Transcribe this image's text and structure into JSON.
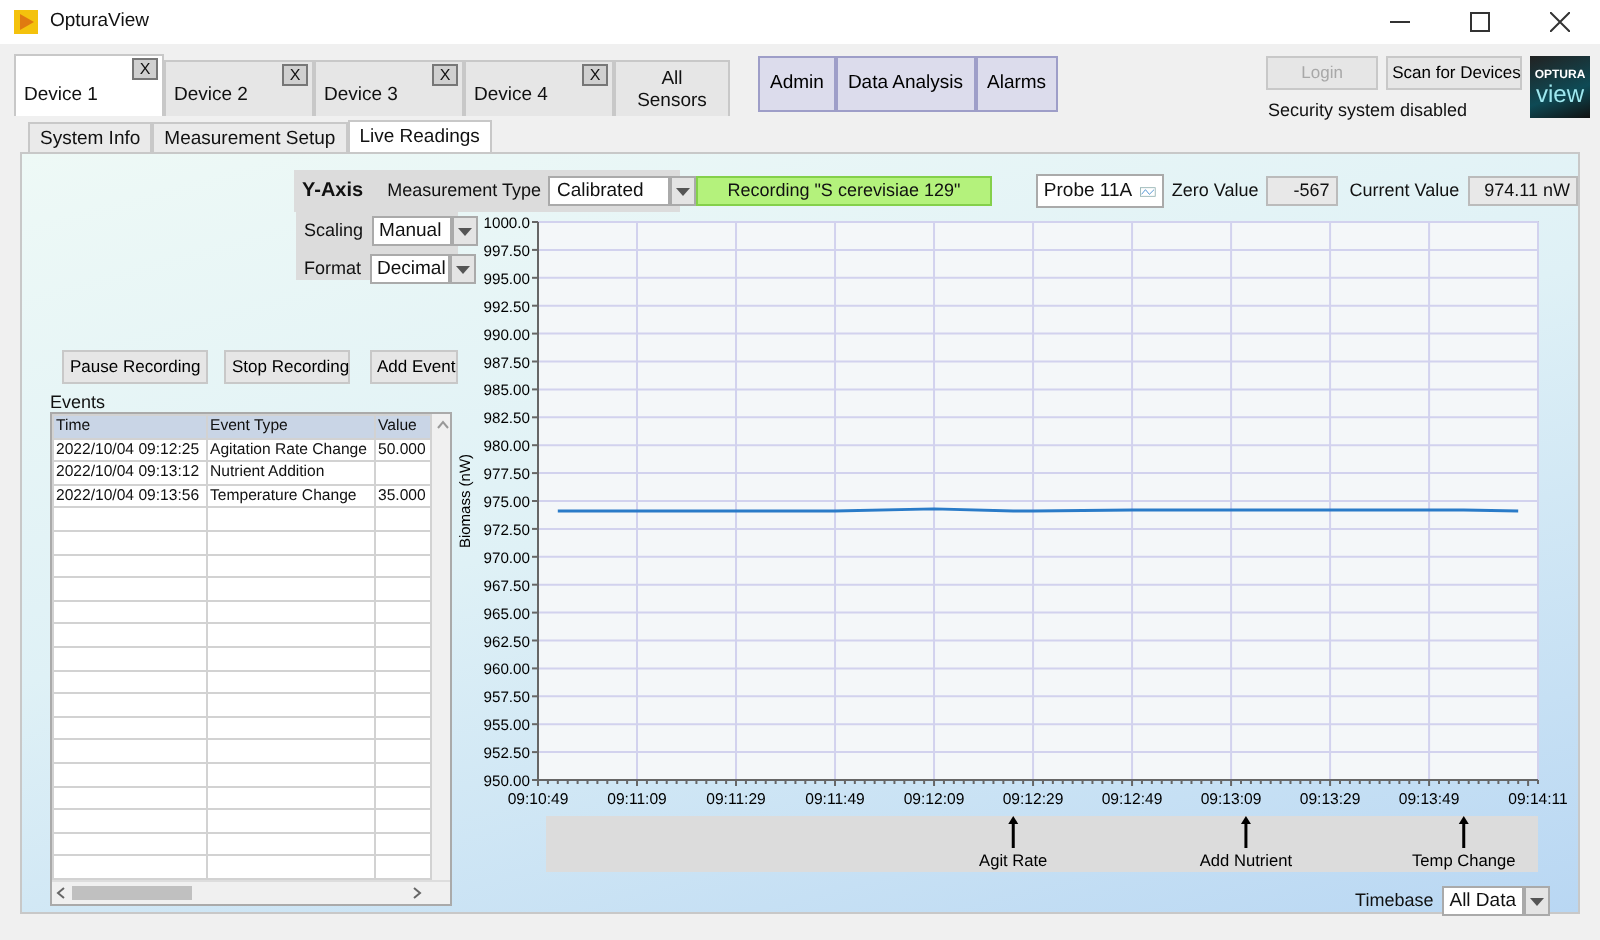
{
  "window": {
    "title": "OpturaView"
  },
  "device_tabs": [
    {
      "label": "Device 1",
      "close": "X",
      "selected": true
    },
    {
      "label": "Device 2",
      "close": "X",
      "selected": false
    },
    {
      "label": "Device 3",
      "close": "X",
      "selected": false
    },
    {
      "label": "Device 4",
      "close": "X",
      "selected": false
    },
    {
      "label": "All Sensors",
      "selected": false
    }
  ],
  "section_tabs": [
    "Admin",
    "Data Analysis",
    "Alarms"
  ],
  "account": {
    "login": {
      "label": "Login",
      "disabled": true
    },
    "scan_button": "Scan for Devices",
    "security_status": "Security system disabled"
  },
  "logo": {
    "line_1": "OPTURA",
    "line_2": "view"
  },
  "sub_tabs": [
    {
      "label": "System Info",
      "selected": false
    },
    {
      "label": "Measurement Setup",
      "selected": false
    },
    {
      "label": "Live Readings",
      "selected": true
    }
  ],
  "y_axis": {
    "title": "Y-Axis",
    "measurement_type": {
      "label": "Measurement Type",
      "value": "Calibrated"
    },
    "scaling": {
      "label": "Scaling",
      "value": "Manual"
    },
    "format": {
      "label": "Format",
      "value": "Decimal"
    }
  },
  "recording_status": "Recording \"S cerevisiae 129\"",
  "zero_value": {
    "label": "Zero Value",
    "value": "-567"
  },
  "current_value": {
    "label": "Current Value",
    "value": "974.11 nW"
  },
  "buttons": [
    "Pause Recording",
    "Stop Recording",
    "Add Event"
  ],
  "events": {
    "title": "Events",
    "columns": [
      "Time",
      "Event Type",
      "Value"
    ],
    "rows": [
      [
        "2022/10/04 09:12:25",
        "Agitation Rate Change",
        "50.000"
      ],
      [
        "2022/10/04 09:13:12",
        "Nutrient Addition",
        ""
      ],
      [
        "2022/10/04 09:13:56",
        "Temperature Change",
        "35.000"
      ]
    ]
  },
  "chart": {
    "chart_data": {
      "type": "line",
      "ylabel": "Biomass (nW)",
      "x": [
        33053,
        33069,
        33089,
        33109,
        33129,
        33145,
        33149,
        33169,
        33189,
        33192,
        33209,
        33229,
        33236,
        33247
      ],
      "series": [
        {
          "name": "Probe 11A",
          "color": "#2a7bc8",
          "values": [
            974.1,
            974.1,
            974.1,
            974.1,
            974.3,
            974.1,
            974.1,
            974.2,
            974.2,
            974.2,
            974.2,
            974.2,
            974.2,
            974.1
          ]
        }
      ],
      "grid": true,
      "xlim": [
        33049,
        33251
      ],
      "ylim": [
        950,
        1000
      ],
      "xticks": [
        {
          "value": 33049,
          "label": "09:10:49"
        },
        {
          "value": 33069,
          "label": "09:11:09"
        },
        {
          "value": 33089,
          "label": "09:11:29"
        },
        {
          "value": 33109,
          "label": "09:11:49"
        },
        {
          "value": 33129,
          "label": "09:12:09"
        },
        {
          "value": 33149,
          "label": "09:12:29"
        },
        {
          "value": 33169,
          "label": "09:12:49"
        },
        {
          "value": 33189,
          "label": "09:13:09"
        },
        {
          "value": 33209,
          "label": "09:13:29"
        },
        {
          "value": 33229,
          "label": "09:13:49"
        },
        {
          "value": 33251,
          "label": "09:14:11"
        }
      ],
      "yticks": [
        {
          "value": 1000,
          "label": "1000.0"
        },
        {
          "value": 997.5,
          "label": "997.50"
        },
        {
          "value": 995,
          "label": "995.00"
        },
        {
          "value": 992.5,
          "label": "992.50"
        },
        {
          "value": 990,
          "label": "990.00"
        },
        {
          "value": 987.5,
          "label": "987.50"
        },
        {
          "value": 985,
          "label": "985.00"
        },
        {
          "value": 982.5,
          "label": "982.50"
        },
        {
          "value": 980,
          "label": "980.00"
        },
        {
          "value": 977.5,
          "label": "977.50"
        },
        {
          "value": 975,
          "label": "975.00"
        },
        {
          "value": 972.5,
          "label": "972.50"
        },
        {
          "value": 970,
          "label": "970.00"
        },
        {
          "value": 967.5,
          "label": "967.50"
        },
        {
          "value": 965,
          "label": "965.00"
        },
        {
          "value": 962.5,
          "label": "962.50"
        },
        {
          "value": 960,
          "label": "960.00"
        },
        {
          "value": 957.5,
          "label": "957.50"
        },
        {
          "value": 955,
          "label": "955.00"
        },
        {
          "value": 952.5,
          "label": "952.50"
        },
        {
          "value": 950,
          "label": "950.00"
        }
      ],
      "annotations": [
        {
          "x": 33145,
          "text": "Agit Rate"
        },
        {
          "x": 33192,
          "text": "Add Nutrient"
        },
        {
          "x": 33236,
          "text": "Temp Change"
        }
      ]
    }
  },
  "timebase": {
    "label": "Timebase",
    "value": "All Data"
  }
}
